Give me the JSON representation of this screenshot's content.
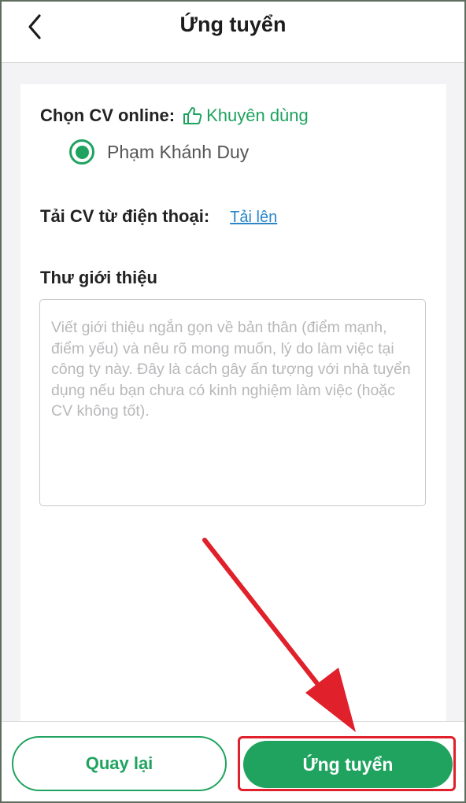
{
  "header": {
    "title": "Ứng tuyển",
    "back_icon": "chevron-left-icon"
  },
  "cv_online": {
    "label": "Chọn CV online:",
    "recommend_icon": "thumbs-up-icon",
    "recommend_text": "Khuyên dùng",
    "selected_cv": "Phạm Khánh Duy"
  },
  "upload": {
    "label": "Tải CV từ điện thoại:",
    "link": "Tải lên"
  },
  "intro": {
    "title": "Thư giới thiệu",
    "placeholder": "Viết giới thiệu ngắn gọn về bản thân (điểm mạnh, điểm yếu) và nêu rõ mong muốn, lý do làm việc tại công ty này. Đây là cách gây ấn tượng với nhà tuyển dụng nếu bạn chưa có kinh nghiệm làm việc (hoặc CV không tốt).",
    "value": ""
  },
  "footer": {
    "back_label": "Quay lại",
    "apply_label": "Ứng tuyển"
  },
  "colors": {
    "accent": "#1fa35f",
    "link": "#2a86c8",
    "annotation": "#e0202a"
  }
}
